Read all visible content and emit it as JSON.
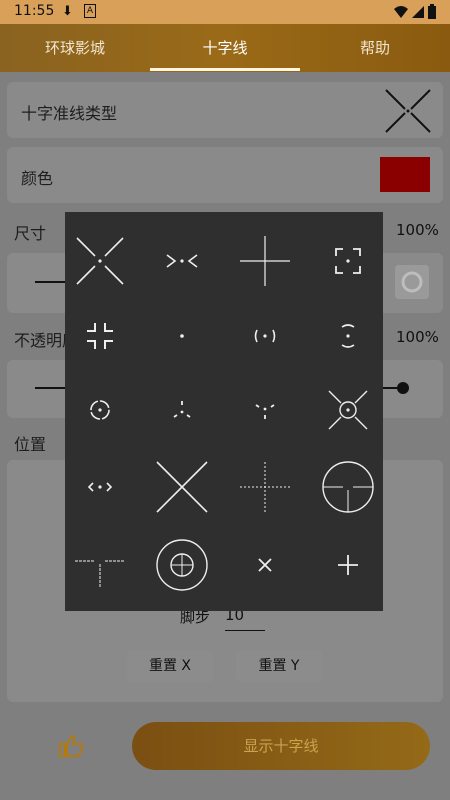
{
  "status": {
    "time": "11:55"
  },
  "tabs": [
    {
      "label": "环球影城"
    },
    {
      "label": "十字线"
    },
    {
      "label": "帮助"
    }
  ],
  "settings": {
    "type_label": "十字准线类型",
    "color_label": "颜色",
    "color_value": "#8a0000",
    "size_label": "尺寸",
    "size_pct": "100%",
    "opacity_label": "不透明度",
    "opacity_pct": "100%",
    "position_label": "位置",
    "step_label": "脚步",
    "step_value": "10",
    "reset_x": "重置 X",
    "reset_y": "重置 Y"
  },
  "show_button": "显示十字线",
  "crosshair_options": [
    "x-long",
    "arrows-dot",
    "plus-long",
    "square-brackets",
    "corners-plus",
    "dot",
    "paren-dot",
    "circle-gap",
    "circle-dot",
    "triangle-ticks",
    "triangle-down",
    "x-circle",
    "diamond-arrows",
    "x-large",
    "plus-dotted",
    "scope-circle",
    "t-ruler",
    "scope-ring",
    "x-small",
    "plus-small"
  ]
}
